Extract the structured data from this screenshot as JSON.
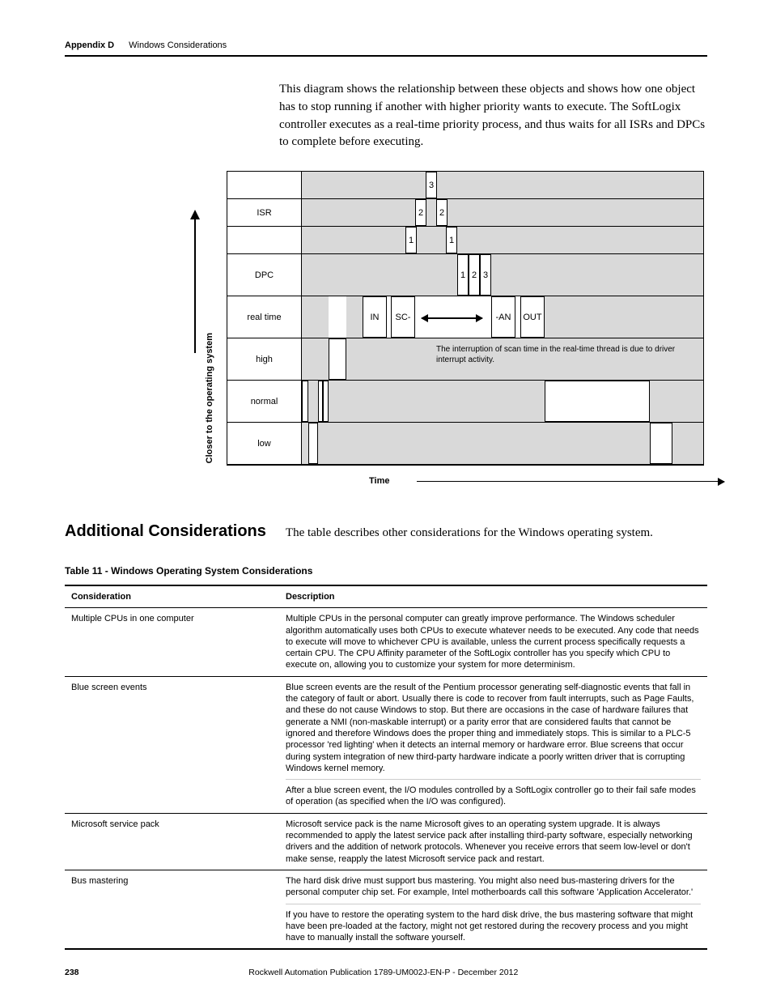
{
  "header": {
    "appendix": "Appendix D",
    "title": "Windows Considerations"
  },
  "intro": "This diagram shows the relationship between these objects and shows how one object has to stop running if another with higher priority wants to execute. The SoftLogix controller executes as a real-time priority process, and thus waits for all ISRs and DPCs to complete before executing.",
  "diagram": {
    "closer_label": "Closer to the operating system",
    "rows": {
      "isr": "ISR",
      "dpc": "DPC",
      "real": "real time",
      "high": "high",
      "normal": "normal",
      "low": "low"
    },
    "boxes": {
      "isr3": "3",
      "isr2a": "2",
      "isr2b": "2",
      "isr1a": "1",
      "isr1b": "1",
      "dpc1": "1",
      "dpc2": "2",
      "dpc3": "3",
      "rt_in": "IN",
      "rt_sc": "SC-",
      "rt_an": "-AN",
      "rt_out": "OUT"
    },
    "interrupt_note": "The interruption of scan time in the real-time thread is due to driver interrupt activity.",
    "time_label": "Time"
  },
  "section": {
    "heading": "Additional Considerations",
    "para": "The table describes other considerations for the Windows operating system."
  },
  "table": {
    "caption": "Table 11 - Windows Operating System Considerations",
    "h0": "Consideration",
    "h1": "Description",
    "rows": [
      {
        "c": "Multiple CPUs in one computer",
        "d": "Multiple CPUs in the personal computer can greatly improve performance. The Windows scheduler algorithm automatically uses both CPUs to execute whatever needs to be executed. Any code that needs to execute will move to whichever CPU is available, unless the current process specifically requests a certain CPU. The CPU Affinity parameter of the SoftLogix controller has you specify which CPU to execute on, allowing you to customize your system for more determinism."
      },
      {
        "c": "Blue screen events",
        "d": "Blue screen events are the result of the Pentium processor generating self-diagnostic events that fall in the category of fault or abort. Usually there is code to recover from fault interrupts, such as Page Faults, and these do not cause Windows to stop. But there are occasions in the case of hardware failures that generate a NMI (non-maskable interrupt) or a parity error that are considered faults that cannot be ignored and therefore Windows does the proper thing and immediately stops. This is similar to a PLC-5 processor 'red lighting' when it detects an internal memory or hardware error. Blue screens that occur during system integration of new third-party hardware indicate a poorly written driver that is corrupting Windows kernel memory.",
        "d2": "After a blue screen event, the I/O modules controlled by a SoftLogix controller go to their fail safe modes of operation (as specified when the I/O was configured)."
      },
      {
        "c": "Microsoft service pack",
        "d": "Microsoft service pack is the name Microsoft gives to an operating system upgrade. It is always recommended to apply the latest service pack after installing third-party software, especially networking drivers and the addition of network protocols. Whenever you receive errors that seem low-level or don't make sense, reapply the latest Microsoft service pack and restart."
      },
      {
        "c": "Bus mastering",
        "d": "The hard disk drive must support bus mastering. You might also need bus-mastering drivers for the personal computer chip set. For example, Intel motherboards call this software 'Application Accelerator.'",
        "d2": "If you have to restore the operating system to the hard disk drive, the bus mastering software that might have been pre-loaded at the factory, might not get restored during the recovery process and you might have to manually install the software yourself."
      }
    ]
  },
  "footer": {
    "page": "238",
    "pub": "Rockwell Automation Publication 1789-UM002J-EN-P - December 2012"
  }
}
